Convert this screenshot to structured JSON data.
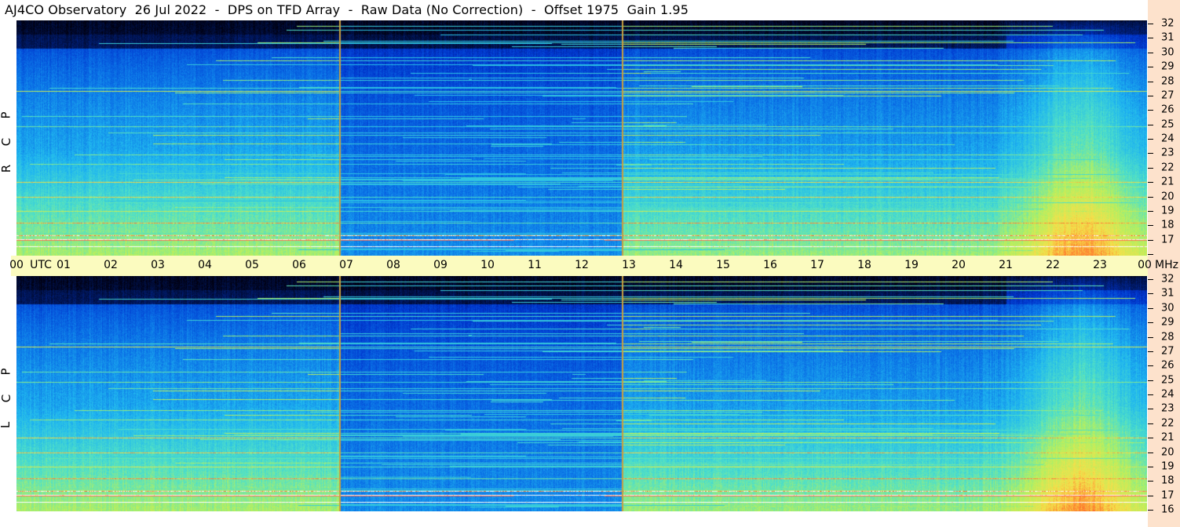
{
  "title": "AJ4CO Observatory  26 Jul 2022  -  DPS on TFD Array  -  Raw Data (No Correction)  -  Offset 1975  Gain 1.95",
  "chart_data": {
    "type": "heatmap",
    "x_axis": {
      "unit_label": "UTC",
      "tick_labels": [
        "00",
        "01",
        "02",
        "03",
        "04",
        "05",
        "06",
        "07",
        "08",
        "09",
        "10",
        "11",
        "12",
        "13",
        "14",
        "15",
        "16",
        "17",
        "18",
        "19",
        "20",
        "21",
        "22",
        "23",
        "00"
      ],
      "range_hours": [
        0,
        24
      ]
    },
    "y_axis": {
      "unit_label": "MHz",
      "range": [
        16,
        32
      ],
      "tick_labels": [
        "32",
        "31",
        "30",
        "29",
        "28",
        "27",
        "26",
        "25",
        "24",
        "23",
        "22",
        "21",
        "20",
        "19",
        "18",
        "17",
        "16"
      ]
    },
    "panels": [
      {
        "name": "RCP",
        "letters": [
          "P",
          "C",
          "R"
        ]
      },
      {
        "name": "LCP",
        "letters": [
          "P",
          "C",
          "L"
        ]
      }
    ],
    "colormap": [
      "#000010",
      "#001a66",
      "#0033cc",
      "#0a6fe6",
      "#1fb6f0",
      "#4fe0c8",
      "#b4f060",
      "#f6e04a",
      "#ff6a2a",
      "#ffffff"
    ],
    "vertical_markers_hours": [
      6.85,
      12.85
    ],
    "marker_color": "#c8a040"
  }
}
